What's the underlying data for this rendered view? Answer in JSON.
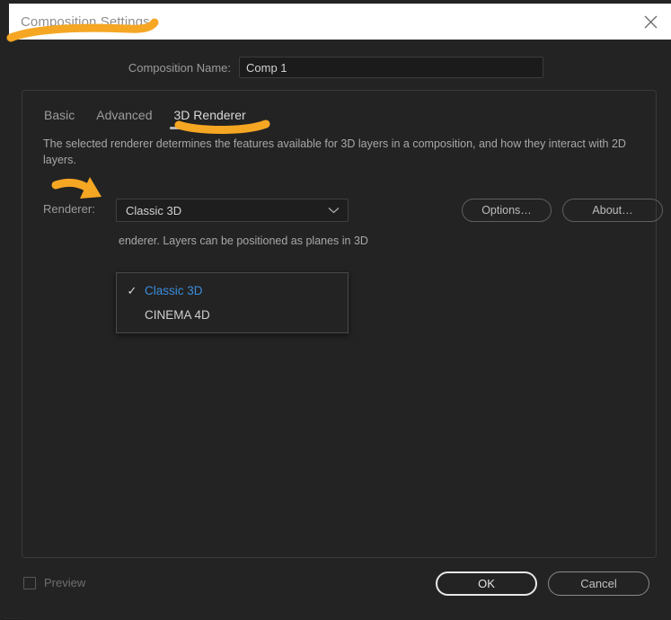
{
  "window": {
    "title": "Composition Settings",
    "close_icon": "close-icon"
  },
  "comp_name": {
    "label": "Composition Name:",
    "value": "Comp 1",
    "placeholder": "Comp 1"
  },
  "tabs": [
    {
      "label": "Basic",
      "active": false
    },
    {
      "label": "Advanced",
      "active": false
    },
    {
      "label": "3D Renderer",
      "active": true
    }
  ],
  "renderer_panel": {
    "description": "The selected renderer determines the features available for 3D layers in a composition, and how they interact with 2D layers.",
    "renderer_label": "Renderer:",
    "selected_renderer": "Classic 3D",
    "chevron_icon": "chevron-down-icon",
    "options_button": "Options…",
    "about_button": "About…",
    "sub_description": "enderer. Layers can be positioned as planes in 3D",
    "menu_items": [
      {
        "label": "Classic 3D",
        "checked": true,
        "check_icon": "check-icon"
      },
      {
        "label": "CINEMA 4D",
        "checked": false,
        "check_icon": ""
      }
    ]
  },
  "footer": {
    "preview_label": "Preview",
    "preview_checked": false,
    "ok_button": "OK",
    "cancel_button": "Cancel"
  },
  "colors": {
    "annotation": "#f5a623",
    "dialog_bg": "#232323",
    "titlebar_bg": "#ffffff",
    "accent_blue": "#3a8cdb",
    "field_bg": "#1b1b1b"
  }
}
